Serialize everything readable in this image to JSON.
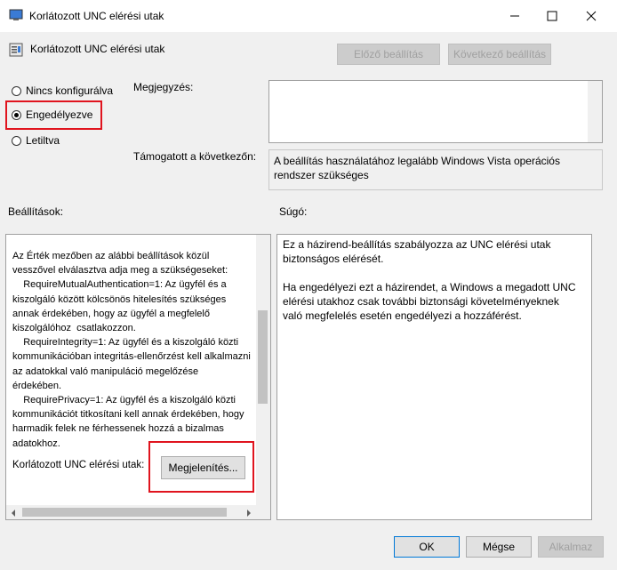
{
  "window": {
    "title": "Korlátozott UNC elérési utak"
  },
  "header": {
    "policy_name": "Korlátozott UNC elérési utak",
    "prev_button": "Előző beállítás",
    "next_button": "Következő beállítás"
  },
  "state": {
    "options": [
      "Nincs konfigurálva",
      "Engedélyezve",
      "Letiltva"
    ],
    "selected": "Engedélyezve"
  },
  "comment": {
    "label": "Megjegyzés:",
    "value": ""
  },
  "supported": {
    "label": "Támogatott a következőn:",
    "value": "A beállítás használatához legalább Windows Vista operációs rendszer szükséges"
  },
  "options_section": {
    "label": "Beállítások:",
    "text": "Az Érték mezőben az alábbi beállítások közül vesszővel elválasztva adja meg a szükségeseket:\n    RequireMutualAuthentication=1: Az ügyfél és a kiszolgáló között kölcsönös hitelesítés szükséges annak érdekében, hogy az ügyfél a megfelelő kiszolgálóhoz  csatlakozzon.\n    RequireIntegrity=1: Az ügyfél és a kiszolgáló közti kommunikációban integritás-ellenőrzést kell alkalmazni az adatokkal való manipuláció megelőzése  érdekében.\n    RequirePrivacy=1: Az ügyfél és a kiszolgáló közti kommunikációt titkosítani kell annak érdekében, hogy harmadik felek ne férhessenek hozzá a bizalmas adatokhoz.",
    "field_label": "Korlátozott UNC elérési utak:",
    "show_button": "Megjelenítés..."
  },
  "help_section": {
    "label": "Súgó:",
    "para1": "Ez a házirend-beállítás szabályozza az UNC elérési utak biztonságos elérését.",
    "para2": "Ha engedélyezi ezt a házirendet, a Windows a megadott UNC elérési utakhoz csak további biztonsági követelményeknek való megfelelés esetén engedélyezi a hozzáférést."
  },
  "footer": {
    "ok": "OK",
    "cancel": "Mégse",
    "apply": "Alkalmaz"
  },
  "colors": {
    "highlight": "#e0141e",
    "accent": "#0078d7"
  }
}
